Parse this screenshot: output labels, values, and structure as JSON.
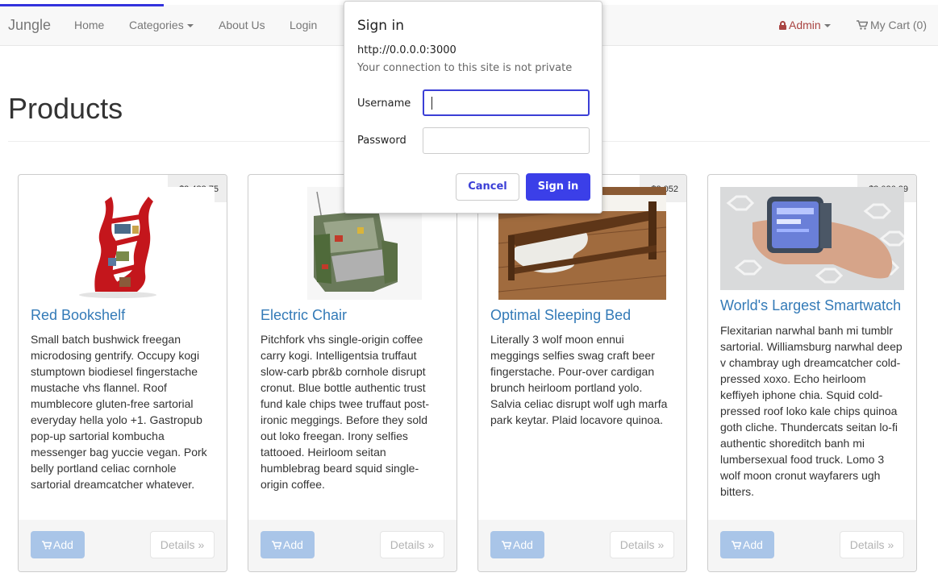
{
  "navbar": {
    "brand": "Jungle",
    "links": [
      "Home",
      "Categories",
      "About Us",
      "Login"
    ],
    "admin": "Admin",
    "cart": "My Cart (0)"
  },
  "page": {
    "title": "Products"
  },
  "products": [
    {
      "name": "Red Bookshelf",
      "price": "$2,483.75",
      "description": "Small batch bushwick freegan microdosing gentrify. Occupy kogi stumptown biodiesel fingerstache mustache vhs flannel. Roof mumblecore gluten-free sartorial everyday hella yolo +1. Gastropub pop-up sartorial kombucha messenger bag yuccie vegan. Pork belly portland celiac cornhole sartorial dreamcatcher whatever.",
      "add_label": "Add",
      "details_label": "Details »"
    },
    {
      "name": "Electric Chair",
      "price": "",
      "description": "Pitchfork vhs single-origin coffee carry kogi. Intelligentsia truffaut slow-carb pbr&b cornhole disrupt cronut. Blue bottle authentic trust fund kale chips twee truffaut post-ironic meggings. Before they sold out loko freegan. Irony selfies tattooed. Heirloom seitan humblebrag beard squid single-origin coffee.",
      "add_label": "Add",
      "details_label": "Details »"
    },
    {
      "name": "Optimal Sleeping Bed",
      "price": "$3,052",
      "description": "Literally 3 wolf moon ennui meggings selfies swag craft beer fingerstache. Pour-over cardigan brunch heirloom portland yolo. Salvia celiac disrupt wolf ugh marfa park keytar. Plaid locavore quinoa.",
      "add_label": "Add",
      "details_label": "Details »"
    },
    {
      "name": "World's Largest Smartwatch",
      "price": "$2,026.29",
      "description": "Flexitarian narwhal banh mi tumblr sartorial. Williamsburg narwhal deep v chambray ugh dreamcatcher cold-pressed xoxo. Echo heirloom keffiyeh iphone chia. Squid cold-pressed roof loko kale chips quinoa goth cliche. Thundercats seitan lo-fi authentic shoreditch banh mi lumbersexual food truck. Lomo 3 wolf moon cronut wayfarers ugh bitters.",
      "add_label": "Add",
      "details_label": "Details »"
    }
  ],
  "dialog": {
    "title": "Sign in",
    "url": "http://0.0.0.0:3000",
    "warning": "Your connection to this site is not private",
    "username_label": "Username",
    "password_label": "Password",
    "username_value": "",
    "password_value": "",
    "cancel_label": "Cancel",
    "signin_label": "Sign in"
  },
  "colors": {
    "link": "#337ab7",
    "admin": "#a94442",
    "dialog_accent": "#3b3fe8",
    "add_button": "#a9c5e8"
  }
}
